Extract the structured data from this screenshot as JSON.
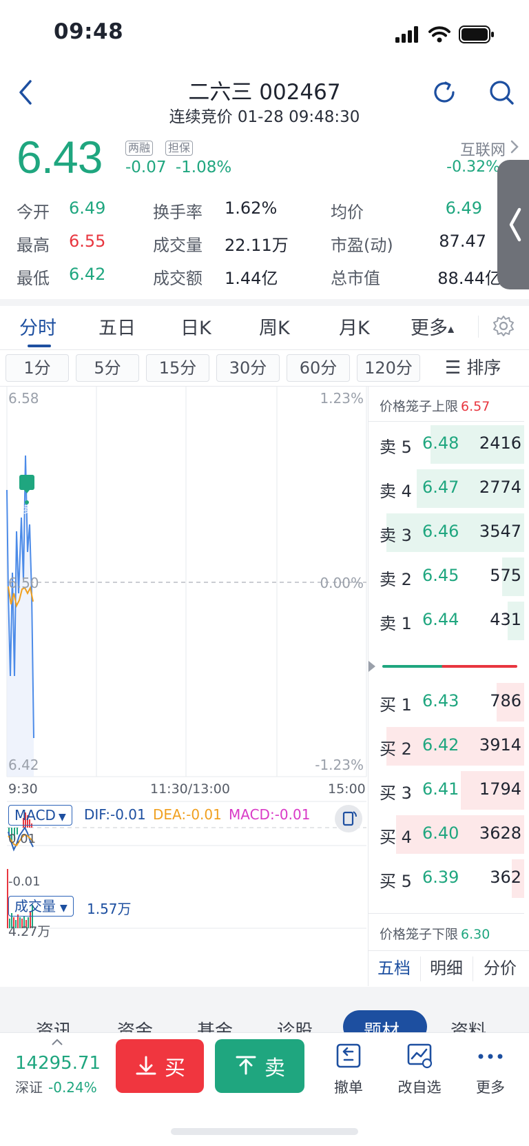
{
  "status": {
    "time": "09:48"
  },
  "header": {
    "title": "二六三 002467",
    "subtitle": "连续竞价 01-28 09:48:30"
  },
  "quote": {
    "price": "6.43",
    "tag1": "两融",
    "tag2": "担保",
    "change": "-0.07",
    "change_pct": "-1.08%",
    "sector": "互联网",
    "sector_change": "-0.32%"
  },
  "stats": {
    "open_label": "今开",
    "open": "6.49",
    "high_label": "最高",
    "high": "6.55",
    "low_label": "最低",
    "low": "6.42",
    "turnover_label": "换手率",
    "turnover": "1.62%",
    "volume_label": "成交量",
    "volume": "22.11万",
    "amount_label": "成交额",
    "amount": "1.44亿",
    "avg_label": "均价",
    "avg": "6.49",
    "pe_label": "市盈(动)",
    "pe": "87.47",
    "mcap_label": "总市值",
    "mcap": "88.44亿"
  },
  "tabs": [
    "分时",
    "五日",
    "日K",
    "周K",
    "月K",
    "更多"
  ],
  "intervals": [
    "1分",
    "5分",
    "15分",
    "30分",
    "60分",
    "120分"
  ],
  "sort_label": "排序",
  "chart": {
    "y_top": "6.58",
    "y_mid": "6.50",
    "y_bot": "6.42",
    "pct_top": "1.23%",
    "pct_mid": "0.00%",
    "pct_bot": "-1.23%",
    "t_start": "9:30",
    "t_mid": "11:30/13:00",
    "t_end": "15:00",
    "sell_marker": "卖"
  },
  "macd": {
    "dropdown": "MACD",
    "dif": "DIF:-0.01",
    "dea": "DEA:-0.01",
    "macd": "MACD:-0.01",
    "top": "0.01",
    "bot": "-0.01"
  },
  "volume": {
    "dropdown": "成交量",
    "current": "1.57万",
    "max": "4.27万"
  },
  "orderbook": {
    "upper_limit_label": "价格笼子上限",
    "upper_limit": "6.57",
    "lower_limit_label": "价格笼子下限",
    "lower_limit": "6.30",
    "asks": [
      {
        "label": "卖 5",
        "price": "6.48",
        "qty": "2416",
        "depth": 0.68
      },
      {
        "label": "卖 4",
        "price": "6.47",
        "qty": "2774",
        "depth": 0.78
      },
      {
        "label": "卖 3",
        "price": "6.46",
        "qty": "3547",
        "depth": 1.0
      },
      {
        "label": "卖 2",
        "price": "6.45",
        "qty": "575",
        "depth": 0.16
      },
      {
        "label": "卖 1",
        "price": "6.44",
        "qty": "431",
        "depth": 0.12
      }
    ],
    "bids": [
      {
        "label": "买 1",
        "price": "6.43",
        "qty": "786",
        "depth": 0.2
      },
      {
        "label": "买 2",
        "price": "6.42",
        "qty": "3914",
        "depth": 1.0
      },
      {
        "label": "买 3",
        "price": "6.41",
        "qty": "1794",
        "depth": 0.46
      },
      {
        "label": "买 4",
        "price": "6.40",
        "qty": "3628",
        "depth": 0.93
      },
      {
        "label": "买 5",
        "price": "6.39",
        "qty": "362",
        "depth": 0.09
      }
    ],
    "ratio_buy": 0.55,
    "foot_tabs": [
      "五档",
      "明细",
      "分价"
    ]
  },
  "sub_tabs": [
    "资讯",
    "资金",
    "基金",
    "诊股",
    "题材",
    "资料"
  ],
  "bottom": {
    "index_value": "14295.71",
    "index_name": "深证",
    "index_change": "-0.24%",
    "buy": "买",
    "sell": "卖",
    "cancel": "撤单",
    "watchlist": "改自选",
    "more": "更多"
  },
  "colors": {
    "up": "#e8363f",
    "down": "#1fa67f",
    "accent": "#1d4fa0"
  }
}
